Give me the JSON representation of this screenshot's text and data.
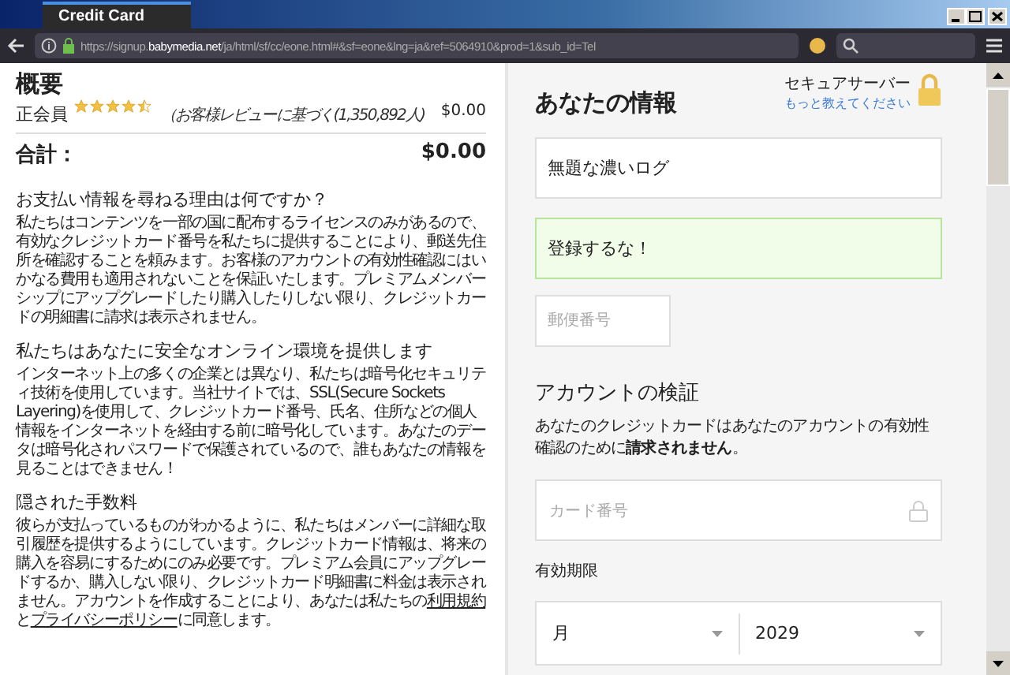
{
  "window": {
    "tab_title": "Credit Card",
    "url": "https://signup.**babymedia.net**/ja/html/sf/cc/eone.html#&sf=eone&lng=ja&ref=5064910&prod=1&sub_id=Tel"
  },
  "summary": {
    "title": "概要",
    "plan": "正会員",
    "stars": 4.5,
    "review_note": "（お客様レビューに基づく(1,350,892人)",
    "price": "$0.00",
    "total_label": "合計：",
    "total": "$0.00"
  },
  "sections": [
    {
      "heading": "お支払い情報を尋ねる理由は何ですか？",
      "parts": [
        {
          "kind": "text",
          "text": "私たちはコンテンツを一部の国に配布するライセンスのみがあるので、有効なクレジットカード番号を私たちに提供することにより、郵送先住所を確認することを頼みます。お客様のアカウントの有効性確認にはいかなる費用も適用されないことを保証いたします。プレミアムメンバーシップにアップグレードしたり購入したりしない限り、クレジットカードの明細書に請求は表示されません。"
        }
      ]
    },
    {
      "heading": "私たちはあなたに安全なオンライン環境を提供します",
      "parts": [
        {
          "kind": "text",
          "text": "インターネット上の多くの企業とは異なり、私たちは暗号化セキュリティ技術を使用しています。当社サイトでは、SSL(Secure Sockets Layering)を使用して、クレジットカード番号、氏名、住所などの個人情報をインターネットを経由する前に暗号化しています。あなたのデータは暗号化されパスワードで保護されているので、誰もあなたの情報を見ることはできません！"
        }
      ]
    },
    {
      "heading": "隠された手数料",
      "parts": [
        {
          "kind": "text",
          "text": "彼らが支払っているものがわかるように、私たちはメンバーに詳細な取引履歴を提供するようにしています。クレジットカード情報は、将来の購入を容易にするためにのみ必要です。プレミアム会員にアップグレードするか、購入しない限り、クレジットカード明細書に料金は表示されません。アカウントを作成することにより、あなたは私たちの"
        },
        {
          "kind": "link",
          "text": "利用規約"
        },
        {
          "kind": "text",
          "text": "と"
        },
        {
          "kind": "link",
          "text": "プライバシーポリシー"
        },
        {
          "kind": "text",
          "text": "に同意します。"
        }
      ]
    }
  ],
  "info": {
    "title": "あなたの情報",
    "secure_label": "セキュアサーバー",
    "learn_more": "もっと教えてください",
    "fields": [
      {
        "kind": "text",
        "value": "無題な濃いログ",
        "valid": false
      },
      {
        "kind": "text",
        "value": "登録するな！",
        "valid": true
      },
      {
        "kind": "short",
        "placeholder": "郵便番号",
        "valid": false
      }
    ]
  },
  "verify": {
    "title": "アカウントの検証",
    "note": "あなたのクレジットカードはあなたのアカウントの有効性確認のために**請求されません**。",
    "card_placeholder": "カード番号",
    "expiry_label": "有効期限",
    "month": "月",
    "year": "2029"
  }
}
